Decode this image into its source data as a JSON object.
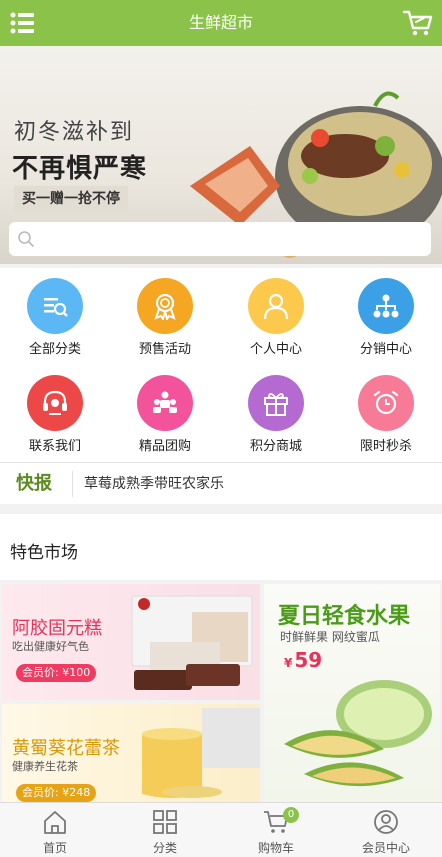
{
  "header": {
    "title": "生鲜超市",
    "menu_icon": "list-menu-icon",
    "cart_icon": "shopping-cart-icon",
    "color": "#8bc34a"
  },
  "banner": {
    "line1": "初冬滋补到",
    "line2": "不再惧严寒",
    "promo": "买一赠一抢不停"
  },
  "search": {
    "placeholder": "",
    "icon": "search-icon"
  },
  "grid": {
    "items": [
      {
        "label": "全部分类",
        "icon": "category-search-icon",
        "color": "#5bb8f5"
      },
      {
        "label": "预售活动",
        "icon": "award-badge-icon",
        "color": "#f5a623"
      },
      {
        "label": "个人中心",
        "icon": "user-icon",
        "color": "#fcc94d"
      },
      {
        "label": "分销中心",
        "icon": "network-icon",
        "color": "#3ca0e6"
      },
      {
        "label": "联系我们",
        "icon": "headset-icon",
        "color": "#ec4848"
      },
      {
        "label": "精品团购",
        "icon": "group-icon",
        "color": "#f2539b"
      },
      {
        "label": "积分商城",
        "icon": "gift-icon",
        "color": "#b56ad2"
      },
      {
        "label": "限时秒杀",
        "icon": "alarm-clock-icon",
        "color": "#f77b97"
      }
    ]
  },
  "ticker": {
    "tag": "快报",
    "text": "草莓成熟季带旺农家乐"
  },
  "featured": {
    "title": "特色市场",
    "cards": [
      {
        "title": "阿胶固元糕",
        "subtitle": "吃出健康好气色",
        "price": "会员价: ¥100"
      },
      {
        "title": "黄蜀葵花蕾茶",
        "subtitle": "健康养生花茶",
        "price": "会员价: ¥248"
      },
      {
        "title": "夏日轻食水果",
        "subtitle": "时鲜鲜果 网纹蜜瓜",
        "price_symbol": "¥",
        "price": "59"
      }
    ]
  },
  "tabbar": {
    "items": [
      {
        "label": "首页",
        "icon": "home-icon"
      },
      {
        "label": "分类",
        "icon": "category-grid-icon"
      },
      {
        "label": "购物车",
        "icon": "cart-icon",
        "badge": "0"
      },
      {
        "label": "会员中心",
        "icon": "member-icon"
      }
    ]
  }
}
